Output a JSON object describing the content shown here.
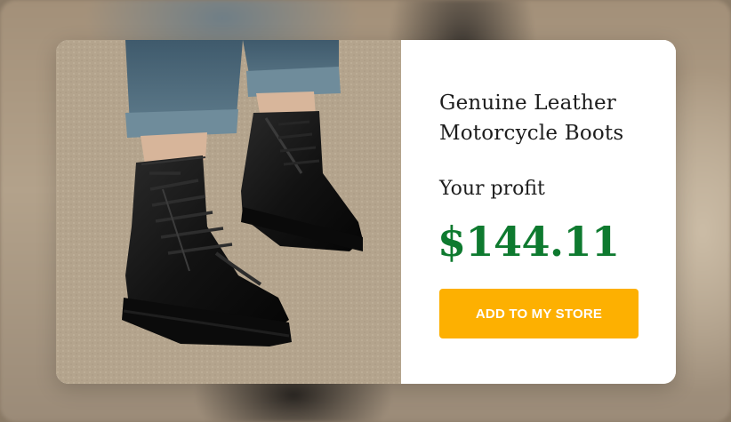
{
  "product": {
    "title": "Genuine Leather Motorcycle Boots",
    "image_icon": "boots-photo",
    "profit_label": "Your profit",
    "profit_value": "$144.11",
    "cta_label": "ADD TO MY STORE"
  },
  "colors": {
    "profit_green": "#0e7a2f",
    "cta_yellow": "#fdb001",
    "card_background": "#ffffff"
  }
}
